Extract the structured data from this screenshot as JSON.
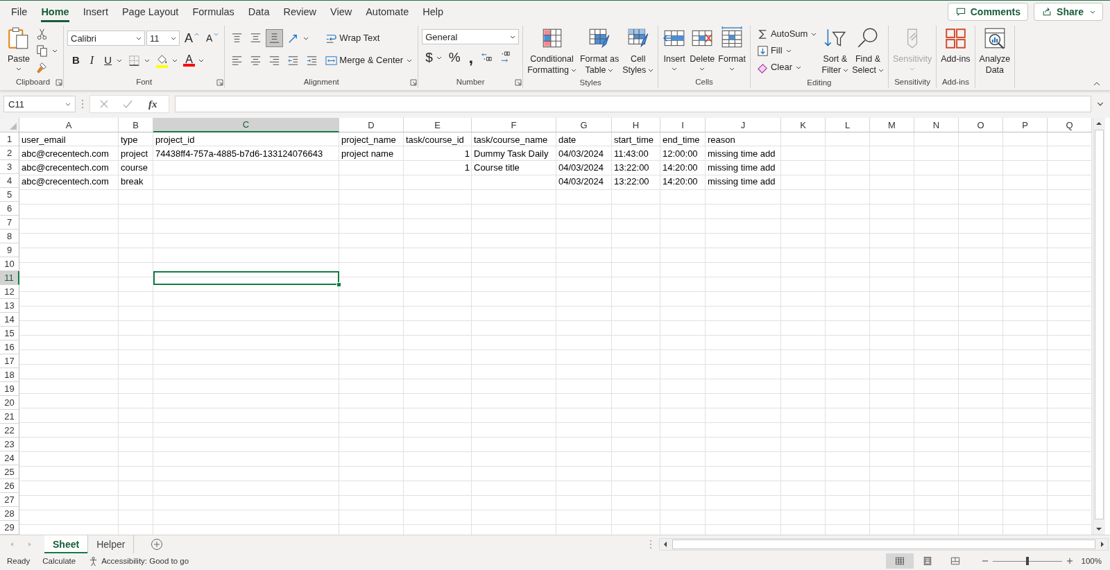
{
  "menu_tabs": [
    {
      "label": "File",
      "selected": false
    },
    {
      "label": "Home",
      "selected": true
    },
    {
      "label": "Insert",
      "selected": false
    },
    {
      "label": "Page Layout",
      "selected": false
    },
    {
      "label": "Formulas",
      "selected": false
    },
    {
      "label": "Data",
      "selected": false
    },
    {
      "label": "Review",
      "selected": false
    },
    {
      "label": "View",
      "selected": false
    },
    {
      "label": "Automate",
      "selected": false
    },
    {
      "label": "Help",
      "selected": false
    }
  ],
  "header_buttons": [
    {
      "kind": "comment",
      "label": "Comments"
    },
    {
      "kind": "share",
      "label": "Share",
      "menu": true
    }
  ],
  "ribbon_groups": [
    {
      "label": "Clipboard",
      "launcher": true,
      "columns": [
        {
          "kind": "clipboard",
          "lines": [
            "Paste"
          ],
          "menu": true
        },
        {
          "tiers": [
            {
              "items": [
                {
                  "kind": "scissors"
                }
              ]
            },
            {
              "items": [
                {
                  "kind": "copy",
                  "menu": true
                }
              ]
            },
            {
              "items": [
                {
                  "kind": "paintbrush"
                }
              ]
            }
          ]
        }
      ]
    },
    {
      "label": "Font",
      "launcher": true,
      "columns": [
        {
          "tiers": [
            {
              "items": [
                {
                  "kind": "font-dropdown",
                  "value": "Calibri"
                },
                {
                  "kind": "size-dropdown",
                  "value": "11"
                },
                {
                  "kind": "font-grow",
                  "label": "A"
                },
                {
                  "kind": "font-shrink",
                  "label": "A"
                }
              ]
            },
            {
              "items": [
                {
                  "kind": "bold",
                  "label": "B"
                },
                {
                  "kind": "italic",
                  "label": "I"
                },
                {
                  "kind": "underline",
                  "label": "U",
                  "menu": true
                },
                {
                  "kind": "borders",
                  "menu": true
                },
                {
                  "kind": "fill-color",
                  "color": "#ffff00",
                  "menu": true
                },
                {
                  "kind": "font-color",
                  "label": "A",
                  "color": "#ff0000",
                  "menu": true
                }
              ]
            }
          ]
        }
      ]
    },
    {
      "label": "Alignment",
      "launcher": true,
      "columns": [
        {
          "tiers": [
            {
              "items": [
                {
                  "kind": "align-top",
                  "selected": false
                },
                {
                  "kind": "align-middle",
                  "selected": false
                },
                {
                  "kind": "align-bottom",
                  "selected": true
                },
                {
                  "kind": "orientation",
                  "menu": true
                }
              ]
            },
            {
              "items": [
                {
                  "kind": "align-left",
                  "selected": false
                },
                {
                  "kind": "align-center",
                  "selected": false
                },
                {
                  "kind": "align-right",
                  "selected": false
                },
                {
                  "kind": "indent-decrease"
                },
                {
                  "kind": "indent-increase"
                }
              ]
            }
          ]
        },
        {
          "tiers": [
            {
              "items": [
                {
                  "kind": "wrap-text",
                  "label": "Wrap Text"
                }
              ]
            },
            {
              "items": [
                {
                  "kind": "merge",
                  "label": "Merge & Center",
                  "menu": true
                }
              ]
            }
          ]
        }
      ]
    },
    {
      "label": "Number",
      "launcher": true,
      "columns": [
        {
          "tiers": [
            {
              "items": [
                {
                  "kind": "format-dropdown",
                  "value": "General"
                }
              ]
            },
            {
              "items": [
                {
                  "kind": "currency",
                  "label": "$",
                  "menu": true
                },
                {
                  "kind": "percent",
                  "label": "%"
                },
                {
                  "kind": "comma",
                  "label": ","
                },
                {
                  "kind": "decimal-increase"
                },
                {
                  "kind": "decimal-decrease"
                }
              ]
            }
          ]
        }
      ]
    },
    {
      "label": "Styles",
      "columns": [
        {
          "kind": "conditional-formatting",
          "lines": [
            "Conditional",
            "Formatting"
          ],
          "menu": true
        },
        {
          "kind": "format-as-table",
          "lines": [
            "Format as",
            "Table"
          ],
          "menu": true
        },
        {
          "kind": "cell-styles",
          "lines": [
            "Cell",
            "Styles"
          ],
          "menu": true
        }
      ]
    },
    {
      "label": "Cells",
      "columns": [
        {
          "kind": "insert-cells",
          "lines": [
            "Insert"
          ],
          "menu": true
        },
        {
          "kind": "delete-cells",
          "lines": [
            "Delete"
          ],
          "menu": true
        },
        {
          "kind": "format-cells",
          "lines": [
            "Format"
          ],
          "menu": true
        }
      ]
    },
    {
      "label": "Editing",
      "columns": [
        {
          "tiers": [
            {
              "items": [
                {
                  "kind": "autosum",
                  "label": "AutoSum",
                  "menu": true
                }
              ]
            },
            {
              "items": [
                {
                  "kind": "fill-down",
                  "label": "Fill",
                  "menu": true
                }
              ]
            },
            {
              "items": [
                {
                  "kind": "eraser",
                  "label": "Clear",
                  "menu": true
                }
              ]
            }
          ]
        },
        {
          "kind": "sort-filter",
          "lines": [
            "Sort &",
            "Filter"
          ],
          "menu": true
        },
        {
          "kind": "find",
          "lines": [
            "Find &",
            "Select"
          ],
          "menu": true
        }
      ]
    },
    {
      "label": "Sensitivity",
      "columns": [
        {
          "kind": "sensitivity",
          "lines": [
            "Sensitivity"
          ],
          "menu": true,
          "disabled": true
        }
      ]
    },
    {
      "label": "Add-ins",
      "columns": [
        {
          "kind": "add-ins",
          "lines": [
            "Add-ins"
          ]
        }
      ]
    },
    {
      "columns": [
        {
          "kind": "analyze",
          "lines": [
            "Analyze",
            "Data"
          ]
        }
      ]
    }
  ],
  "formula_bar": {
    "name_box": "C11",
    "function_label": "fx"
  },
  "sheet": {
    "columns": [
      {
        "label": "A",
        "selected": false
      },
      {
        "label": "B",
        "selected": false
      },
      {
        "label": "C",
        "selected": true
      },
      {
        "label": "D",
        "selected": false
      },
      {
        "label": "E",
        "selected": false
      },
      {
        "label": "F",
        "selected": false
      },
      {
        "label": "G",
        "selected": false
      },
      {
        "label": "H",
        "selected": false
      },
      {
        "label": "I",
        "selected": false
      },
      {
        "label": "J",
        "selected": false
      },
      {
        "label": "K",
        "selected": false
      },
      {
        "label": "L",
        "selected": false
      },
      {
        "label": "M",
        "selected": false
      },
      {
        "label": "N",
        "selected": false
      },
      {
        "label": "O",
        "selected": false
      },
      {
        "label": "P",
        "selected": false
      },
      {
        "label": "Q",
        "selected": false
      }
    ],
    "rows": [
      {
        "number": "1",
        "selected": false,
        "cells": [
          "user_email",
          "type",
          "project_id",
          "project_name",
          "task/course_id",
          "task/course_name",
          "date",
          "start_time",
          "end_time",
          "reason"
        ]
      },
      {
        "number": "2",
        "selected": false,
        "cells": [
          "abc@crecentech.com",
          "project",
          "74438ff4-757a-4885-b7d6-133124076643",
          "project name",
          {
            "text": "1",
            "kind": "number"
          },
          "Dummy Task Daily",
          "04/03/2024",
          "11:43:00",
          "12:00:00",
          "missing time add"
        ]
      },
      {
        "number": "3",
        "selected": false,
        "cells": [
          "abc@crecentech.com",
          "course",
          null,
          null,
          {
            "text": "1",
            "kind": "number"
          },
          "Course title",
          "04/03/2024",
          "13:22:00",
          "14:20:00",
          "missing time add"
        ]
      },
      {
        "number": "4",
        "selected": false,
        "cells": [
          "abc@crecentech.com",
          "break",
          null,
          null,
          null,
          null,
          "04/03/2024",
          "13:22:00",
          "14:20:00",
          "missing time add"
        ]
      },
      {
        "number": "5",
        "selected": false
      },
      {
        "number": "6",
        "selected": false
      },
      {
        "number": "7",
        "selected": false
      },
      {
        "number": "8",
        "selected": false
      },
      {
        "number": "9",
        "selected": false
      },
      {
        "number": "10",
        "selected": false
      },
      {
        "number": "11",
        "selected": true
      },
      {
        "number": "12",
        "selected": false
      },
      {
        "number": "13",
        "selected": false
      },
      {
        "number": "14",
        "selected": false
      },
      {
        "number": "15",
        "selected": false
      },
      {
        "number": "16",
        "selected": false
      },
      {
        "number": "17",
        "selected": false
      },
      {
        "number": "18",
        "selected": false
      },
      {
        "number": "19",
        "selected": false
      },
      {
        "number": "20",
        "selected": false
      },
      {
        "number": "21",
        "selected": false
      },
      {
        "number": "22",
        "selected": false
      },
      {
        "number": "23",
        "selected": false
      },
      {
        "number": "24",
        "selected": false
      },
      {
        "number": "25",
        "selected": false
      },
      {
        "number": "26",
        "selected": false
      },
      {
        "number": "27",
        "selected": false
      },
      {
        "number": "28",
        "selected": false
      },
      {
        "number": "29",
        "selected": false
      }
    ]
  },
  "sheet_tabs": [
    {
      "label": "Sheet",
      "selected": true
    },
    {
      "label": "Helper",
      "selected": false
    }
  ],
  "status_bar": {
    "items": [
      "Ready",
      "Calculate"
    ],
    "accessibility": "Accessibility: Good to go",
    "views": [
      {
        "kind": "normal",
        "selected": true
      },
      {
        "kind": "page-layout",
        "selected": false
      },
      {
        "kind": "page-break",
        "selected": false
      }
    ],
    "zoom": {
      "label": "100%",
      "level": 0.5
    }
  }
}
